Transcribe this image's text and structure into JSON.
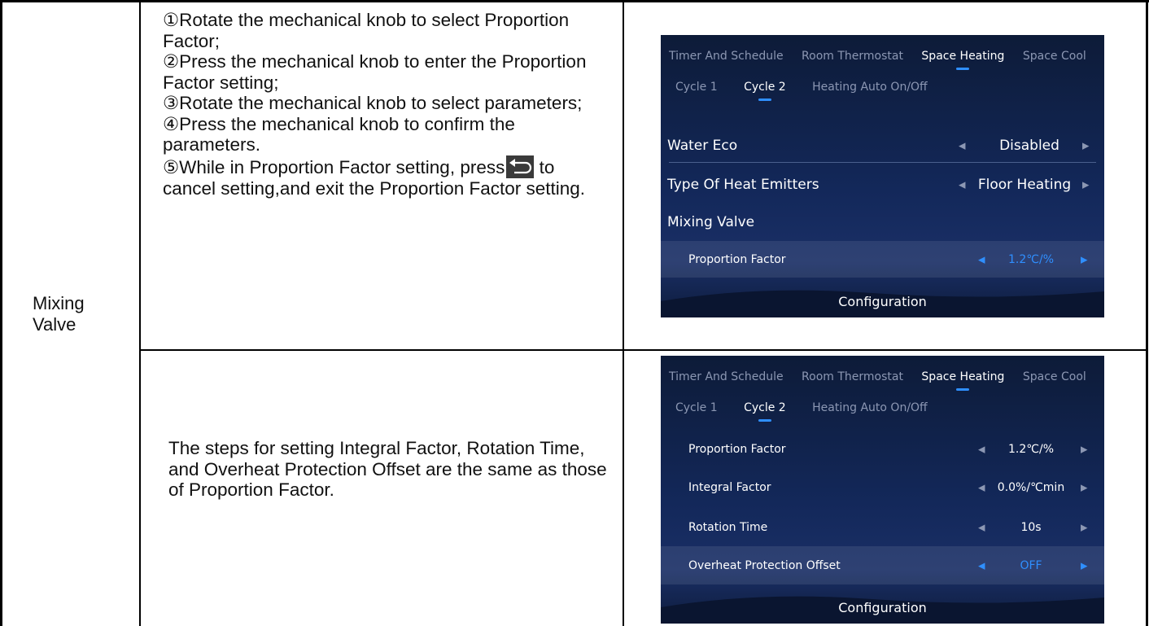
{
  "row_label": "Mixing\nValve",
  "instructions": {
    "step1": "①Rotate the mechanical knob to select Proportion Factor;",
    "step2": "②Press the mechanical knob to enter the Proportion Factor setting;",
    "step3": "③Rotate the mechanical knob to select parameters;",
    "step4": "④Press the mechanical knob to confirm the parameters.",
    "step5_before_icon": "⑤While in Proportion Factor setting, press",
    "step5_after_icon": "to cancel setting,and exit the Proportion Factor setting.",
    "back_icon": "back-arrow-icon"
  },
  "note": "The steps for setting Integral Factor, Rotation Time, and Overheat Protection Offset are the same as those of Proportion Factor.",
  "screen1": {
    "tabs": [
      "Timer And Schedule",
      "Room Thermostat",
      "Space Heating",
      "Space Cool"
    ],
    "active_tab": "Space Heating",
    "subtabs": [
      "Cycle 1",
      "Cycle 2",
      "Heating Auto On/Off"
    ],
    "active_subtab": "Cycle 2",
    "rows": [
      {
        "name": "Water Eco",
        "value": "Disabled"
      },
      {
        "name": "Type Of Heat Emitters",
        "value": "Floor Heating"
      },
      {
        "name": "Mixing Valve",
        "value": ""
      },
      {
        "name": "Proportion Factor",
        "value": "1.2℃/%"
      }
    ],
    "footer": "Configuration"
  },
  "screen2": {
    "tabs": [
      "Timer And Schedule",
      "Room Thermostat",
      "Space Heating",
      "Space Cool"
    ],
    "active_tab": "Space Heating",
    "subtabs": [
      "Cycle 1",
      "Cycle 2",
      "Heating Auto On/Off"
    ],
    "active_subtab": "Cycle 2",
    "rows": [
      {
        "name": "Proportion Factor",
        "value": "1.2℃/%"
      },
      {
        "name": "Integral Factor",
        "value": "0.0%/℃min"
      },
      {
        "name": "Rotation Time",
        "value": "10s"
      },
      {
        "name": "Overheat Protection Offset",
        "value": "OFF"
      }
    ],
    "footer": "Configuration"
  },
  "colors": {
    "accent": "#2f8fff",
    "screen_bg": "#13285a",
    "muted": "#8c97b3"
  }
}
